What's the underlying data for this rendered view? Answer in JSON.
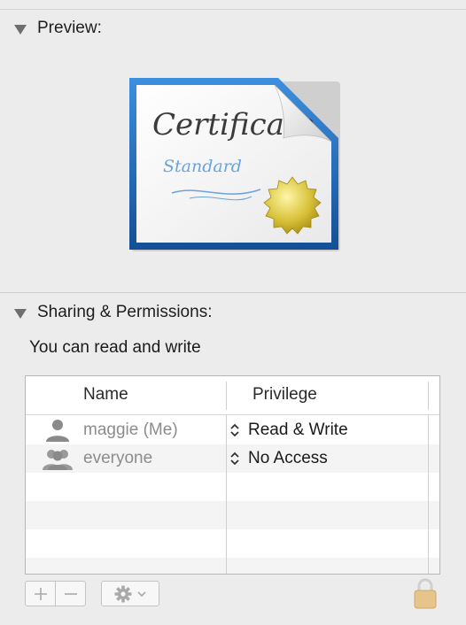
{
  "preview": {
    "header": "Preview:",
    "icon": "certificate-document-icon",
    "certificate_title": "Certificate",
    "certificate_subtitle": "Standard"
  },
  "sharing": {
    "header": "Sharing & Permissions:",
    "access_summary": "You can read and write",
    "table": {
      "columns": [
        "Name",
        "Privilege"
      ],
      "rows": [
        {
          "name": "maggie (Me)",
          "icon": "user-icon",
          "privilege": "Read & Write"
        },
        {
          "name": "everyone",
          "icon": "group-icon",
          "privilege": "No Access"
        }
      ]
    },
    "toolbar": {
      "add_icon": "plus-icon",
      "remove_icon": "minus-icon",
      "action_icon": "gear-icon",
      "lock_icon": "lock-icon"
    }
  },
  "colors": {
    "background": "#ececec",
    "cert_frame_blue": "#1e63ad",
    "seal_gold": "#d9c23a"
  }
}
